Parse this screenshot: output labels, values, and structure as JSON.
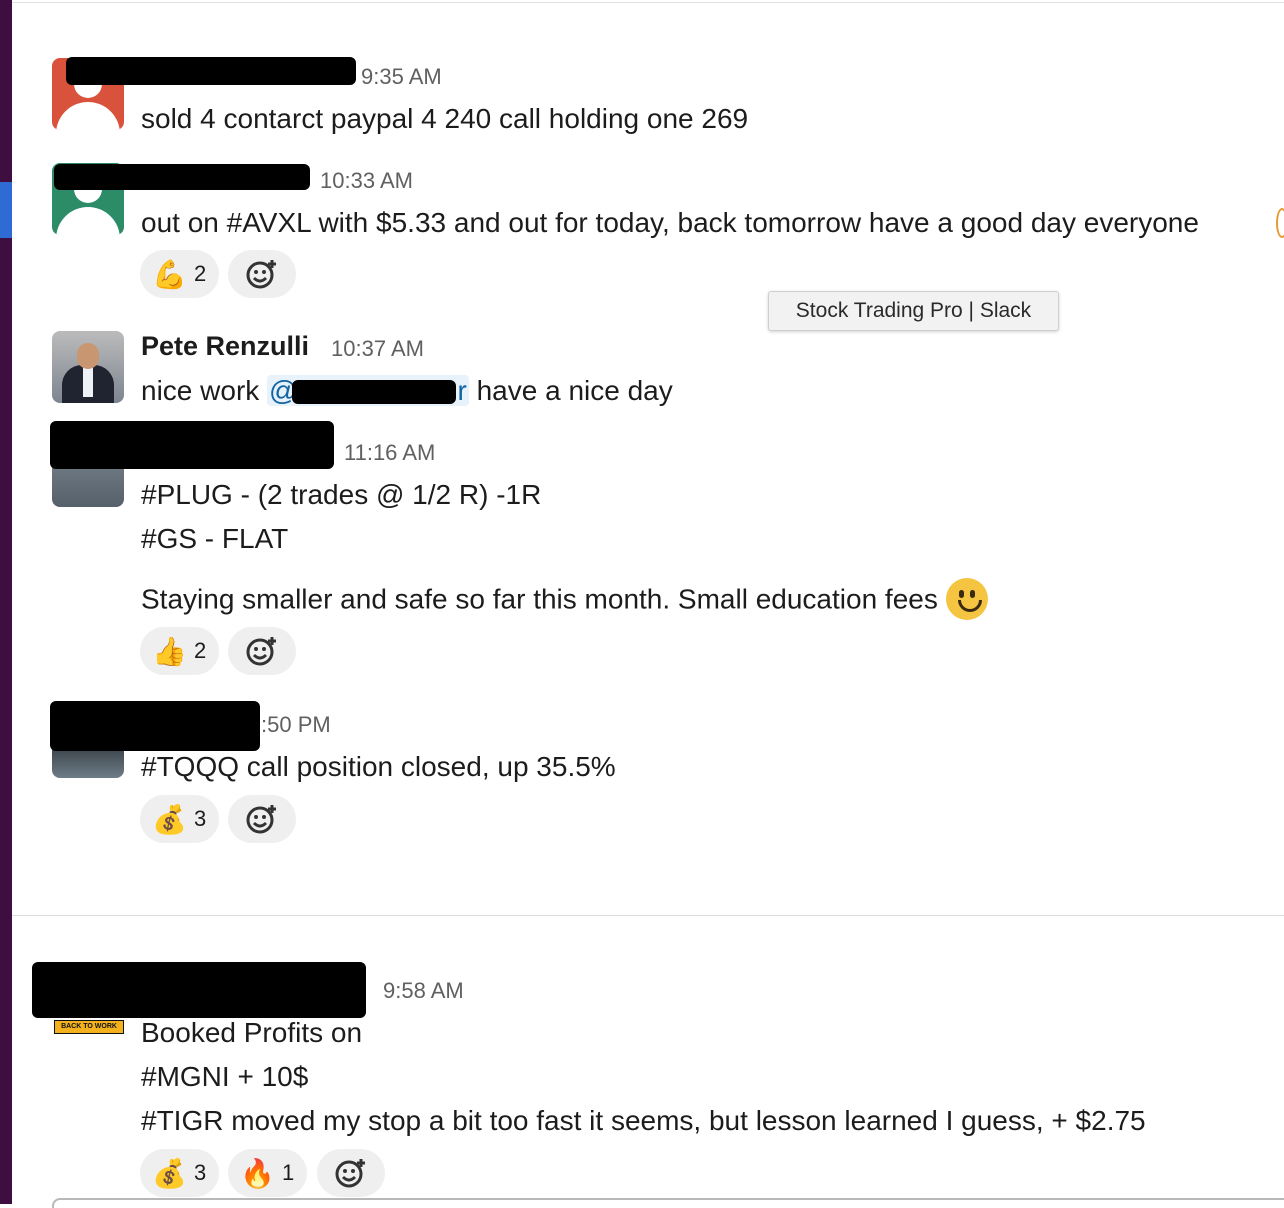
{
  "window": {
    "tooltip": "Stock Trading Pro | Slack"
  },
  "messages": [
    {
      "time": "9:35 AM",
      "lines": [
        "sold 4 contarct paypal 4 240 call holding one 269"
      ]
    },
    {
      "time": "10:33 AM",
      "lines": [
        "out on #AVXL with $5.33 and out for today, back tomorrow have a good day everyone"
      ],
      "reactions": [
        {
          "icon": "flexed-biceps-icon",
          "glyph": "💪",
          "count": "2"
        }
      ]
    },
    {
      "sender": "Pete Renzulli",
      "time": "10:37 AM",
      "text_before": "nice work",
      "mention_prefix": "@",
      "mention_suffix": "r",
      "text_after": "have a nice day"
    },
    {
      "time": "11:16 AM",
      "lines": [
        "#PLUG - (2 trades @ 1/2 R) -1R",
        "#GS - FLAT",
        "Staying smaller and safe so far this month.  Small education fees"
      ],
      "reactions": [
        {
          "icon": "thumbs-up-icon",
          "glyph": "👍",
          "count": "2"
        }
      ]
    },
    {
      "time": ":50 PM",
      "lines": [
        "#TQQQ call position closed, up 35.5%"
      ],
      "reactions": [
        {
          "icon": "money-bag-icon",
          "glyph": "💰",
          "count": "3"
        }
      ]
    },
    {
      "time": "9:58 AM",
      "avatar_text": "BACK TO WORK",
      "lines": [
        "Booked Profits on",
        "#MGNI + 10$",
        "#TIGR moved my stop a bit too fast it seems, but lesson learned I guess, + $2.75"
      ],
      "reactions": [
        {
          "icon": "money-bag-icon",
          "glyph": "💰",
          "count": "3"
        },
        {
          "icon": "fire-icon",
          "glyph": "🔥",
          "count": "1"
        }
      ]
    }
  ]
}
